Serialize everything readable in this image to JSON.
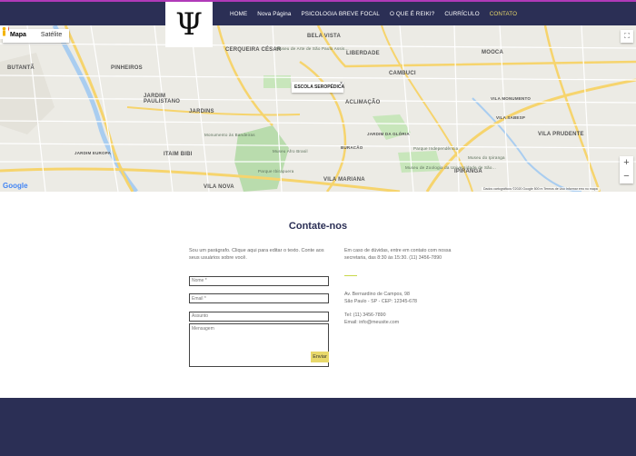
{
  "header": {
    "logo_symbol": "Ψ",
    "nav": [
      {
        "label": "HOME",
        "active": false
      },
      {
        "label": "Nova Página",
        "active": false
      },
      {
        "label": "PSICOLOGIA BREVE FOCAL",
        "active": false
      },
      {
        "label": "O QUE É REIKI?",
        "active": false
      },
      {
        "label": "CURRÍCULO",
        "active": false
      },
      {
        "label": "CONTATO",
        "active": true
      }
    ],
    "colors": {
      "bar": "#2b2f55",
      "accent_line": "#b03ab8",
      "active": "#e8d86a"
    }
  },
  "map": {
    "tabs": [
      "Mapa",
      "Satélite"
    ],
    "selected_tab": "Mapa",
    "info_window": "ESCOLA SEROPÉDICA",
    "labels": {
      "big": [
        "CERQUEIRA CÉSAR",
        "BELA VISTA",
        "LIBERDADE",
        "MOOCA",
        "PINHEIROS",
        "CAMBUCI",
        "BUTANTÃ",
        "JARDIM PAULISTANO",
        "JARDINS",
        "ACLIMAÇÃO",
        "VILA MARIANA",
        "ITAIM BIBI",
        "VILA NOVA",
        "IPIRANGA",
        "VILA PRUDENTE",
        "JARDIM EUROPA",
        "VILA MONUMENTO",
        "VILA SABESP",
        "BURACÃO",
        "JARDIM DA GLÓRIA"
      ],
      "places": [
        "Museu de Arte de São Paulo Assis...",
        "Monumento às Bandeiras",
        "Museu Afro Brasil",
        "Parque Ibirapuera",
        "Museu do Ipiranga",
        "Parque Independência",
        "Museu de Zoologia da Universidade de São..."
      ]
    },
    "logo_text": "Google",
    "attribution": "Dados cartográficos ©2020 Google   500 m   Termos de Uso   Informar erro no mapa",
    "zoom_in": "+",
    "zoom_out": "−"
  },
  "contact": {
    "title": "Contate-nos",
    "intro": "Sou um parágrafo. Clique aqui para editar o texto. Conte aos seus usuários sobre você.",
    "form": {
      "name_placeholder": "Nome *",
      "email_placeholder": "Email *",
      "subject_placeholder": "Assunto",
      "message_placeholder": "Mensagem",
      "submit_label": "Enviar"
    },
    "help_text": "Em caso de dúvidas, entre em contato com nossa secretaria, das 8:30 às 15:30. (11) 3456-7890",
    "address_line1": "Av. Bernardino de Campos, 98",
    "address_line2": "São Paulo - SP - CEP: 12345-678",
    "phone": "Tel: (11) 3456-7890",
    "email": "Email: info@meusite.com"
  },
  "footer": {
    "color": "#2b2f55"
  }
}
